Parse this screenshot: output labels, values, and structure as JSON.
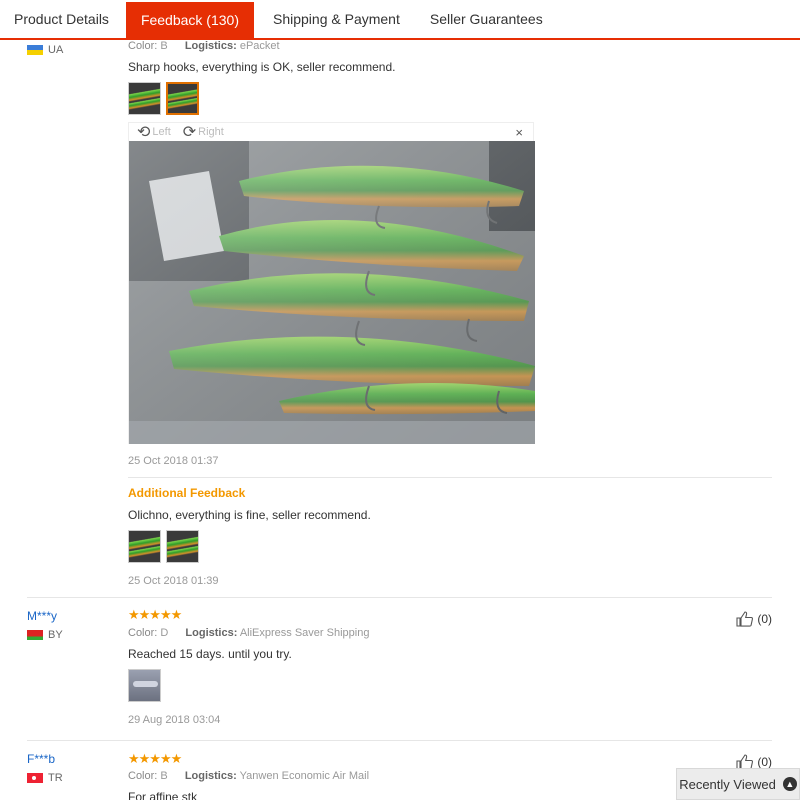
{
  "tabs": [
    {
      "label": "Product Details"
    },
    {
      "label": "Feedback (130)"
    },
    {
      "label": "Shipping & Payment"
    },
    {
      "label": "Seller Guarantees"
    }
  ],
  "reviews": [
    {
      "country": "UA",
      "color_label": "Color:",
      "color": "B",
      "logistics_label": "Logistics:",
      "logistics": "ePacket",
      "text": "Sharp hooks, everything is OK, seller recommend.",
      "date": "25 Oct 2018 01:37",
      "viewer": {
        "left_label": "Left",
        "right_label": "Right",
        "close": "×"
      },
      "additional_label": "Additional Feedback",
      "additional_text": "Olichno, everything is fine, seller recommend.",
      "additional_date": "25 Oct 2018 01:39"
    },
    {
      "user": "M***y",
      "country": "BY",
      "stars": "★★★★★",
      "color_label": "Color:",
      "color": "D",
      "logistics_label": "Logistics:",
      "logistics": "AliExpress Saver Shipping",
      "text": "Reached 15 days. until you try.",
      "date": "29 Aug 2018 03:04",
      "helpful": "(0)"
    },
    {
      "user": "F***b",
      "country": "TR",
      "stars": "★★★★★",
      "color_label": "Color:",
      "color": "B",
      "logistics_label": "Logistics:",
      "logistics": "Yanwen Economic Air Mail",
      "text": "For affine stk",
      "helpful": "(0)"
    }
  ],
  "recently_viewed": {
    "label": "Recently Viewed",
    "icon": "chevron-up-icon"
  },
  "colors": {
    "accent": "#e62e04",
    "star": "#f39800",
    "link": "#1a66c7"
  }
}
